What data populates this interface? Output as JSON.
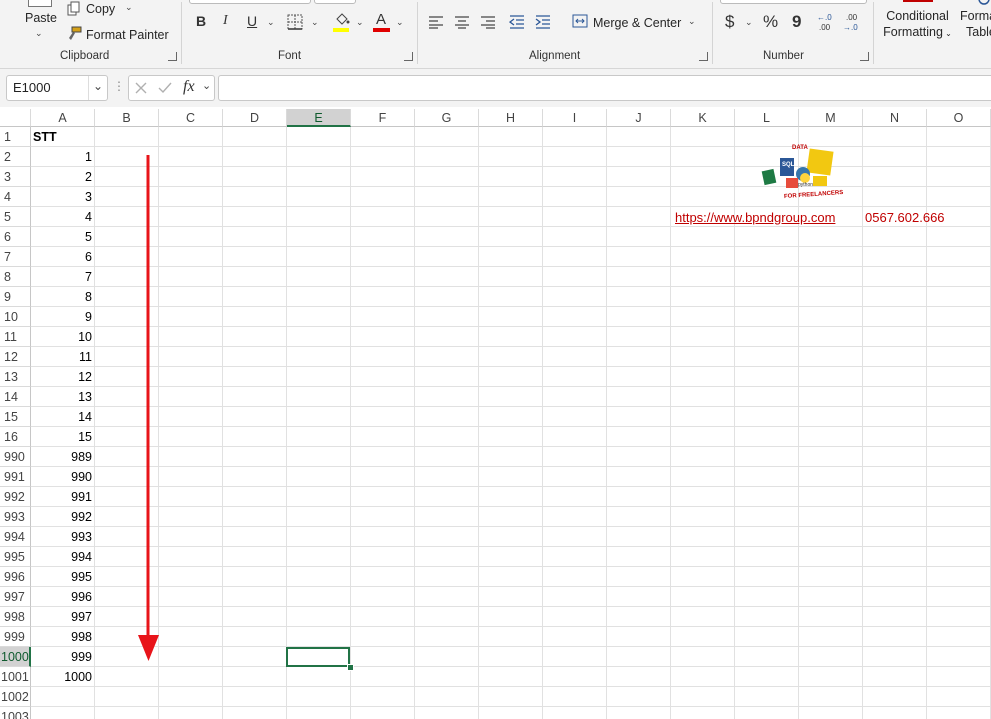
{
  "ribbon": {
    "clipboard": {
      "paste": "Paste",
      "copy": "Copy",
      "format_painter": "Format Painter",
      "label": "Clipboard"
    },
    "font": {
      "bold": "B",
      "italic": "I",
      "underline": "U",
      "font_color_glyph": "A",
      "label": "Font"
    },
    "alignment": {
      "merge_center": "Merge & Center",
      "label": "Alignment"
    },
    "number": {
      "currency": "$",
      "percent": "%",
      "comma": "9",
      "inc_decimal": "←.0\n.00",
      "dec_decimal": ".00\n→.0",
      "label": "Number"
    },
    "styles": {
      "conditional_line1": "Conditional",
      "conditional_line2": "Formatting",
      "format_table_line1": "Forma",
      "format_table_line2": "Table"
    }
  },
  "formula_bar": {
    "name_box": "E1000",
    "fx": "fx",
    "value": ""
  },
  "grid": {
    "columns": [
      "A",
      "B",
      "C",
      "D",
      "E",
      "F",
      "G",
      "H",
      "I",
      "J",
      "K",
      "L",
      "M",
      "N",
      "O"
    ],
    "selected_column": "E",
    "selected_row": "1000",
    "rows": [
      {
        "num": "1",
        "a": "STT"
      },
      {
        "num": "2",
        "a": "1"
      },
      {
        "num": "3",
        "a": "2"
      },
      {
        "num": "4",
        "a": "3"
      },
      {
        "num": "5",
        "a": "4"
      },
      {
        "num": "6",
        "a": "5"
      },
      {
        "num": "7",
        "a": "6"
      },
      {
        "num": "8",
        "a": "7"
      },
      {
        "num": "9",
        "a": "8"
      },
      {
        "num": "10",
        "a": "9"
      },
      {
        "num": "11",
        "a": "10"
      },
      {
        "num": "12",
        "a": "11"
      },
      {
        "num": "13",
        "a": "12"
      },
      {
        "num": "14",
        "a": "13"
      },
      {
        "num": "15",
        "a": "14"
      },
      {
        "num": "16",
        "a": "15"
      },
      {
        "num": "990",
        "a": "989"
      },
      {
        "num": "991",
        "a": "990"
      },
      {
        "num": "992",
        "a": "991"
      },
      {
        "num": "993",
        "a": "992"
      },
      {
        "num": "994",
        "a": "993"
      },
      {
        "num": "995",
        "a": "994"
      },
      {
        "num": "996",
        "a": "995"
      },
      {
        "num": "997",
        "a": "996"
      },
      {
        "num": "998",
        "a": "997"
      },
      {
        "num": "999",
        "a": "998"
      },
      {
        "num": "1000",
        "a": "999"
      },
      {
        "num": "1001",
        "a": "1000"
      },
      {
        "num": "1002",
        "a": ""
      },
      {
        "num": "1003",
        "a": ""
      }
    ]
  },
  "overlay": {
    "logo_text": [
      "DATA",
      "SQL",
      "python",
      "FOR FREELANCERS"
    ],
    "link": "https://www.bpndgroup.com",
    "phone": "0567.602.666"
  },
  "colors": {
    "accent_green": "#217346",
    "arrow_red": "#e8141a",
    "link_red": "#c00000",
    "font_color_bar": "#e00000",
    "highlight_yellow": "#ffff00"
  }
}
